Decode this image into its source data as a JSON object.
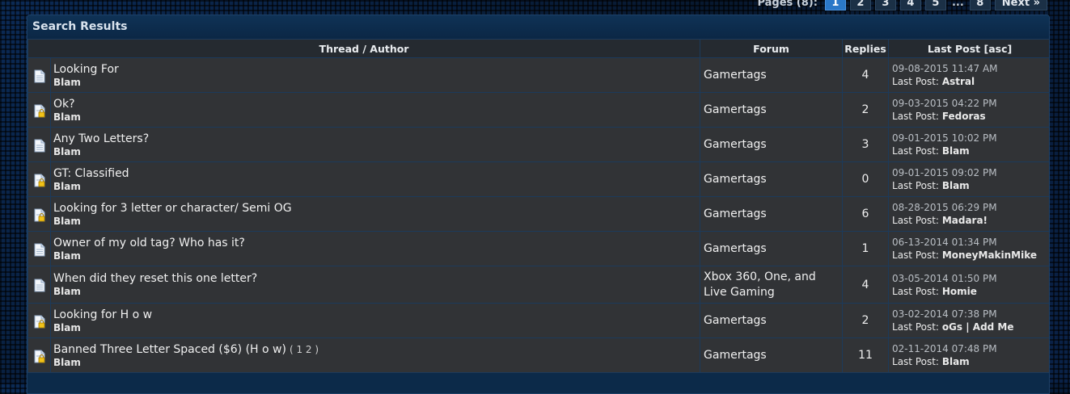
{
  "pagination": {
    "label": "Pages (8):",
    "pages": [
      "1",
      "2",
      "3",
      "4",
      "5"
    ],
    "current": "1",
    "ellipsis": "...",
    "last": "8",
    "next": "Next »"
  },
  "panel": {
    "title": "Search Results"
  },
  "columns": {
    "thread": "Thread / Author",
    "forum": "Forum",
    "replies": "Replies",
    "lastpost": "Last Post [asc]"
  },
  "lastpost_prefix": "Last Post:",
  "rows": [
    {
      "title": "Looking For",
      "author": "Blam",
      "pages": "",
      "forum": "Gamertags",
      "replies": "4",
      "date": "09-08-2015 11:47 AM",
      "last_by": "Astral",
      "icon": "thread-icon"
    },
    {
      "title": "Ok?",
      "author": "Blam",
      "pages": "",
      "forum": "Gamertags",
      "replies": "2",
      "date": "09-03-2015 04:22 PM",
      "last_by": "Fedoras",
      "icon": "locked-thread-icon"
    },
    {
      "title": "Any Two Letters?",
      "author": "Blam",
      "pages": "",
      "forum": "Gamertags",
      "replies": "3",
      "date": "09-01-2015 10:02 PM",
      "last_by": "Blam",
      "icon": "thread-icon"
    },
    {
      "title": "GT: Classified",
      "author": "Blam",
      "pages": "",
      "forum": "Gamertags",
      "replies": "0",
      "date": "09-01-2015 09:02 PM",
      "last_by": "Blam",
      "icon": "locked-thread-icon"
    },
    {
      "title": "Looking for 3 letter or character/ Semi OG",
      "author": "Blam",
      "pages": "",
      "forum": "Gamertags",
      "replies": "6",
      "date": "08-28-2015 06:29 PM",
      "last_by": "Madara!",
      "icon": "locked-thread-icon"
    },
    {
      "title": "Owner of my old tag? Who has it?",
      "author": "Blam",
      "pages": "",
      "forum": "Gamertags",
      "replies": "1",
      "date": "06-13-2014 01:34 PM",
      "last_by": "MoneyMakinMike",
      "icon": "thread-icon"
    },
    {
      "title": "When did they reset this one letter?",
      "author": "Blam",
      "pages": "",
      "forum": "Xbox 360, One, and Live Gaming",
      "replies": "4",
      "date": "03-05-2014 01:50 PM",
      "last_by": "Homie",
      "icon": "thread-icon"
    },
    {
      "title": "Looking for H o w",
      "author": "Blam",
      "pages": "",
      "forum": "Gamertags",
      "replies": "2",
      "date": "03-02-2014 07:38 PM",
      "last_by": "oGs | Add Me",
      "icon": "locked-thread-icon"
    },
    {
      "title": "Banned Three Letter Spaced ($6) (H o w)",
      "author": "Blam",
      "pages": "( 1 2 )",
      "forum": "Gamertags",
      "replies": "11",
      "date": "02-11-2014 07:48 PM",
      "last_by": "Blam",
      "icon": "locked-thread-icon"
    }
  ]
}
